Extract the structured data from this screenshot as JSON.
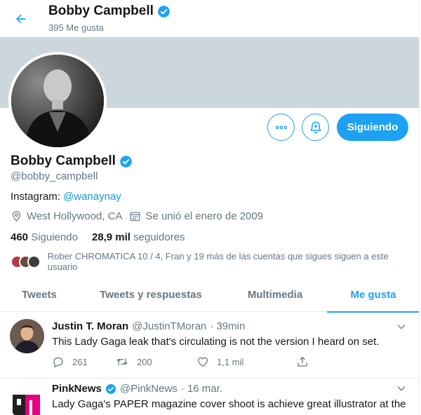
{
  "header": {
    "name": "Bobby Campbell",
    "subtitle": "395 Me gusta"
  },
  "profile": {
    "name": "Bobby Campbell",
    "handle": "@bobby_campbell",
    "bio_prefix": "Instagram: ",
    "bio_link": "@wanaynay",
    "location": "West Hollywood, CA",
    "joined": "Se unió el enero de 2009",
    "following_count": "460",
    "following_label": "Siguiendo",
    "followers_count": "28,9 mil",
    "followers_label": "seguidores",
    "followed_by": "Rober CHROMATICA 10 / 4, Fran y 19 más de las cuentas que sigues siguen a este usuario"
  },
  "actions": {
    "follow_label": "Siguiendo"
  },
  "tabs": [
    {
      "label": "Tweets"
    },
    {
      "label": "Tweets y respuestas"
    },
    {
      "label": "Multimedia"
    },
    {
      "label": "Me gusta"
    }
  ],
  "tweets": [
    {
      "name": "Justin T. Moran",
      "handle": "@JustinTMoran",
      "time": "· 39min",
      "text": "This Lady Gaga leak that's circulating is not the version I heard on set.",
      "replies": "261",
      "retweets": "200",
      "likes": "1,1 mil"
    },
    {
      "name": "PinkNews",
      "handle": "@PinkNews",
      "time": "· 16 mar.",
      "text": "Lady Gaga's PAPER magazine cover shoot is achieve great illustrator at the"
    }
  ],
  "colors": {
    "accent": "#1da1f2",
    "banner": "#ccd6dd",
    "secondary_text": "#657786"
  }
}
